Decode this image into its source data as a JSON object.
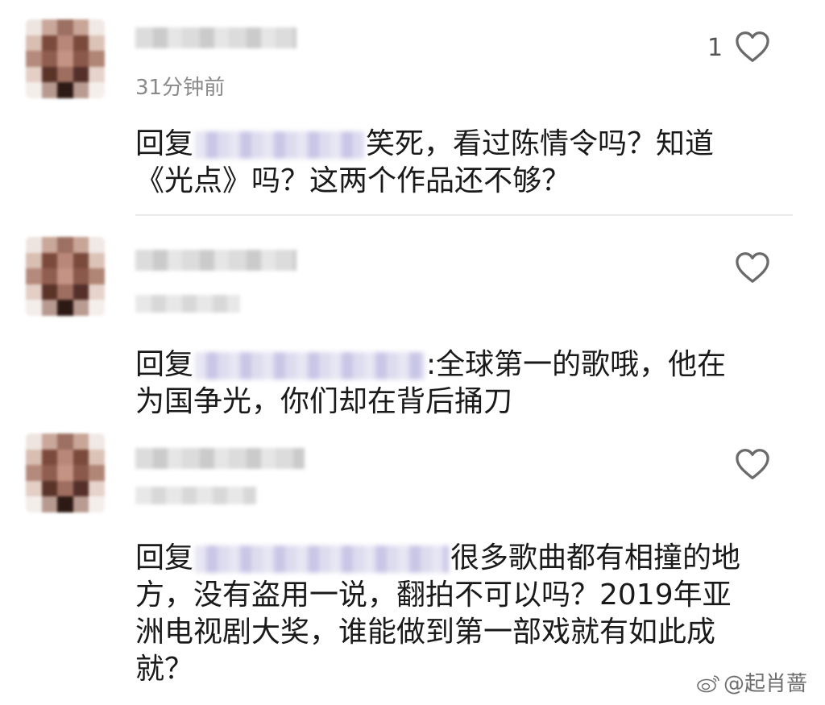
{
  "comments": [
    {
      "time": "31分钟前",
      "like_count": "1",
      "reply_prefix": "回复",
      "reply_text_line1": "笑死，看过陈情令吗？知道",
      "reply_text_line2": "《光点》吗？这两个作品还不够？"
    },
    {
      "like_count": "",
      "reply_prefix": "回复",
      "reply_text_line1": ":全球第一的歌哦，他在",
      "reply_text_line2": "为国争光，你们却在背后捅刀"
    },
    {
      "like_count": "",
      "reply_prefix": "回复",
      "reply_text_line1": "很多歌曲都有相撞的地",
      "reply_text_line2": "方，没有盗用一说，翻拍不可以吗？2019年亚",
      "reply_text_line3": "洲电视剧大奖，谁能做到第一部戏就有如此成",
      "reply_text_line4": "就？"
    }
  ],
  "watermark": "@起肖蔷",
  "icons": {
    "like": "heart-outline-icon",
    "weibo": "weibo-logo-icon"
  },
  "colors": {
    "text": "#1a1a1a",
    "timestamp": "#8a8a8a",
    "heart": "#6a6a6a",
    "mention_blur": "#c9c6e6"
  }
}
